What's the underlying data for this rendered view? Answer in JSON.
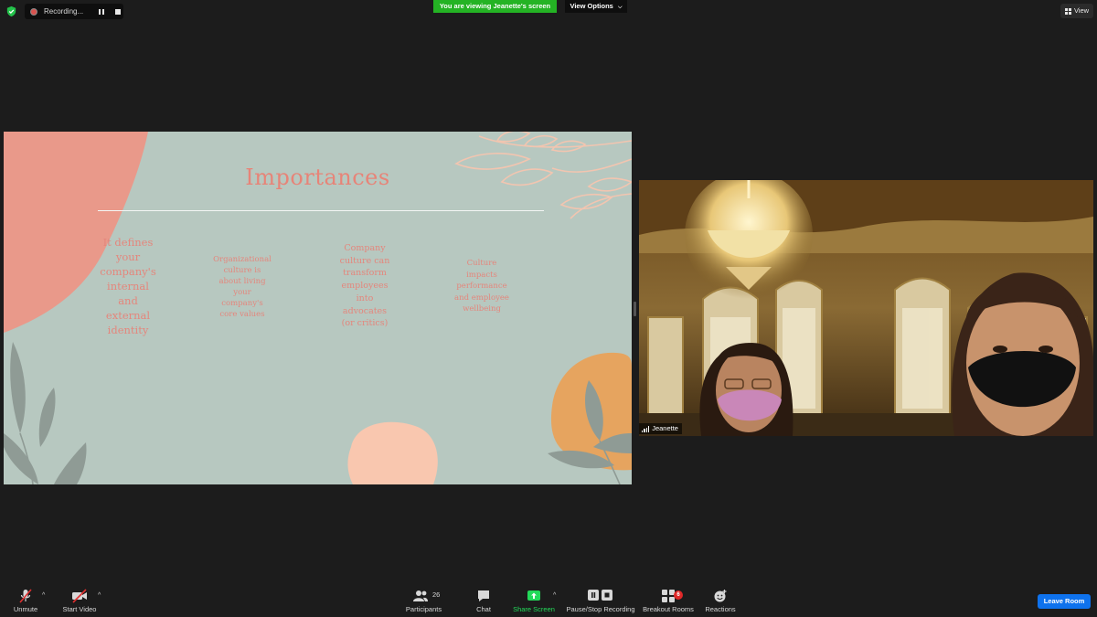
{
  "top_bar": {
    "recording_label": "Recording...",
    "viewing_banner": "You are viewing Jeanette's screen",
    "view_options_label": "View Options",
    "view_label": "View"
  },
  "slide": {
    "title": "Importances",
    "columns": [
      [
        "It defines",
        "your",
        "company's",
        "internal",
        "and",
        "external",
        "identity"
      ],
      [
        "Organizational",
        "culture is",
        "about living",
        "your",
        "company's",
        "core values"
      ],
      [
        "Company",
        "culture can",
        "transform",
        "employees",
        "into",
        "advocates",
        "(or critics)"
      ],
      [
        "Culture",
        "impacts",
        "performance",
        "and employee",
        "wellbeing"
      ]
    ]
  },
  "video": {
    "participant_name": "Jeanette"
  },
  "toolbar": {
    "unmute_label": "Unmute",
    "start_video_label": "Start Video",
    "participants_label": "Participants",
    "participants_count": "26",
    "chat_label": "Chat",
    "share_screen_label": "Share Screen",
    "recording_label": "Pause/Stop Recording",
    "breakout_label": "Breakout Rooms",
    "breakout_badge": "6",
    "reactions_label": "Reactions",
    "leave_label": "Leave Room"
  },
  "colors": {
    "background": "#1c1c1c",
    "banner_green": "#24b324",
    "share_green": "#23d959",
    "leave_blue": "#0e72ed",
    "slide_bg": "#b7c8c0",
    "slide_text": "#e4867c"
  }
}
